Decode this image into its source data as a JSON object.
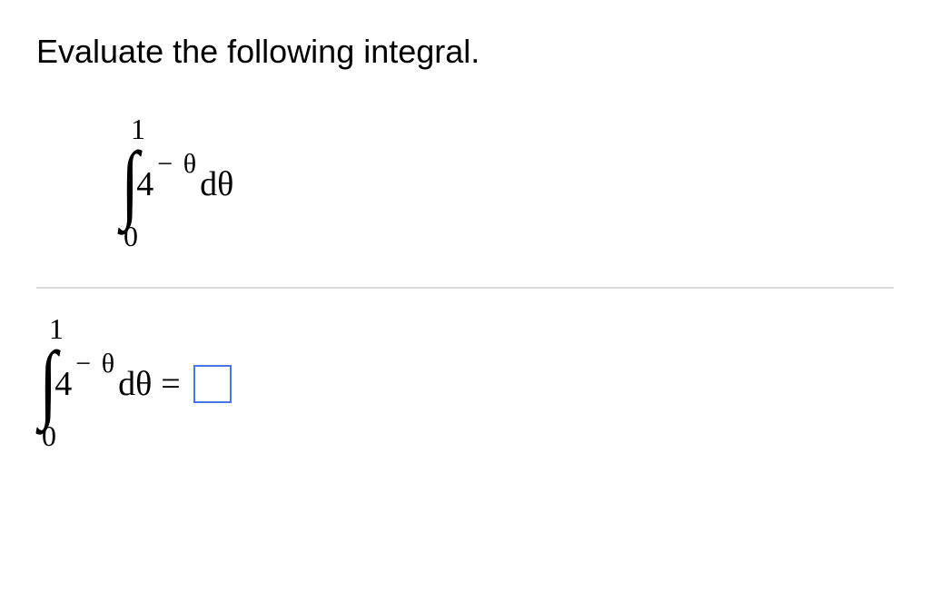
{
  "prompt": "Evaluate the following integral.",
  "integral": {
    "upper_limit": "1",
    "lower_limit": "0",
    "base": "4",
    "exponent": "− θ",
    "differential": "dθ"
  },
  "answer_row": {
    "upper_limit": "1",
    "lower_limit": "0",
    "base": "4",
    "exponent": "− θ",
    "differential": "dθ",
    "equals": "="
  }
}
